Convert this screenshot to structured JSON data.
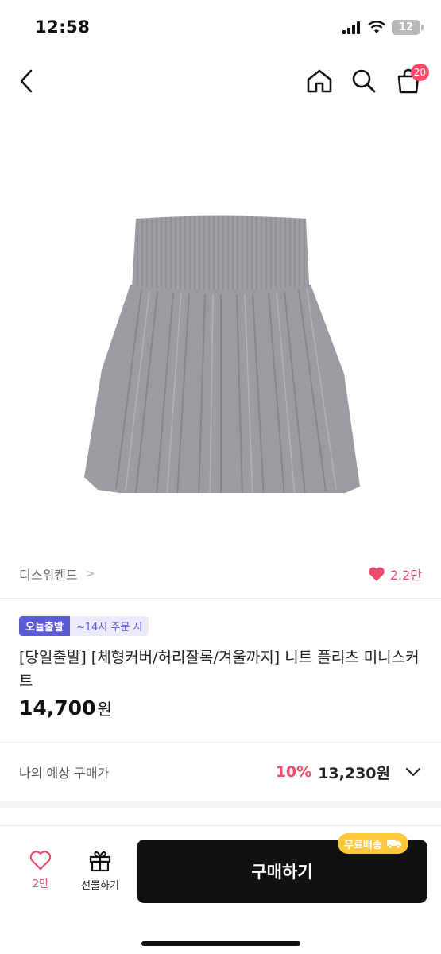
{
  "status_bar": {
    "time": "12:58",
    "battery": "12"
  },
  "nav": {
    "back_icon": "chevron-left-icon",
    "home_icon": "home-icon",
    "search_icon": "search-icon",
    "cart_icon": "shopping-bag-icon",
    "cart_count": "20"
  },
  "brand": {
    "name": "디스위켄드",
    "chevron": ">",
    "like_count": "2.2만"
  },
  "product": {
    "badge_dispatch": "오늘출발",
    "badge_time": "~14시 주문 시",
    "title": "[당일출발] [체형커버/허리잘록/겨울까지] 니트 플리츠 미니스커트",
    "price": "14,700",
    "price_unit": "원"
  },
  "expected": {
    "label": "나의 예상 구매가",
    "discount": "10%",
    "price": "13,230원"
  },
  "bottom_bar": {
    "like_count": "2만",
    "gift_label": "선물하기",
    "buy_label": "구매하기",
    "free_shipping": "무료배송"
  },
  "colors": {
    "accent_pink": "#ef4b6c",
    "dispatch_purple": "#5b5bd6",
    "free_ship_yellow": "#ffc83d"
  }
}
